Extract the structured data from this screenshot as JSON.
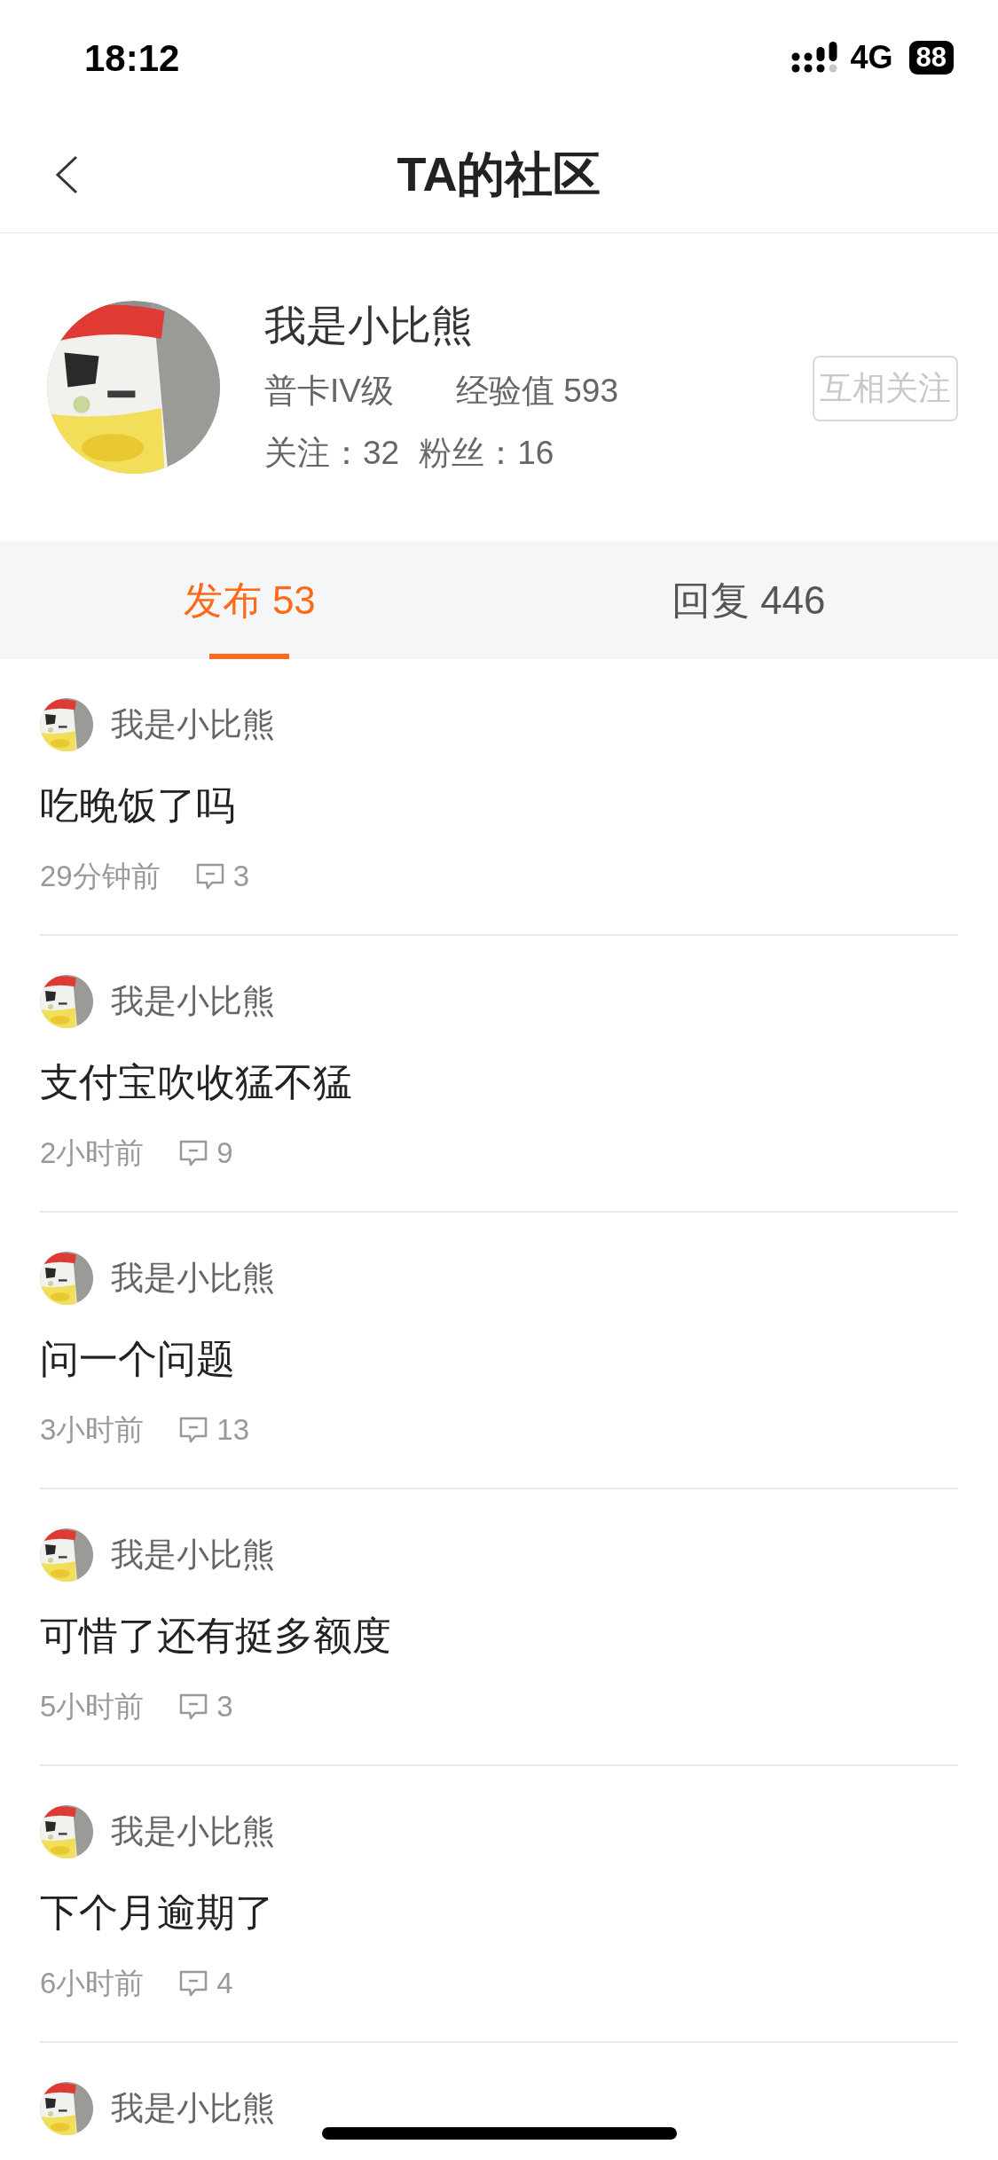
{
  "status_bar": {
    "time": "18:12",
    "network": "4G",
    "battery": "88"
  },
  "header": {
    "title": "TA的社区"
  },
  "profile": {
    "name": "我是小比熊",
    "level": "普卡IV级",
    "experience": "经验值 593",
    "following": "关注：32",
    "followers": "粉丝：16",
    "follow_button": {
      "label": "互相关注",
      "disabled": true
    }
  },
  "tabs": [
    {
      "label": "发布 53",
      "selected": true
    },
    {
      "label": "回复 446",
      "selected": false
    }
  ],
  "posts": [
    {
      "author": "我是小比熊",
      "title": "吃晚饭了吗",
      "time": "29分钟前",
      "comments": "3"
    },
    {
      "author": "我是小比熊",
      "title": "支付宝吹收猛不猛",
      "time": "2小时前",
      "comments": "9"
    },
    {
      "author": "我是小比熊",
      "title": "问一个问题",
      "time": "3小时前",
      "comments": "13"
    },
    {
      "author": "我是小比熊",
      "title": "可惜了还有挺多额度",
      "time": "5小时前",
      "comments": "3"
    },
    {
      "author": "我是小比熊",
      "title": "下个月逾期了",
      "time": "6小时前",
      "comments": "4"
    },
    {
      "author": "我是小比熊"
    }
  ]
}
